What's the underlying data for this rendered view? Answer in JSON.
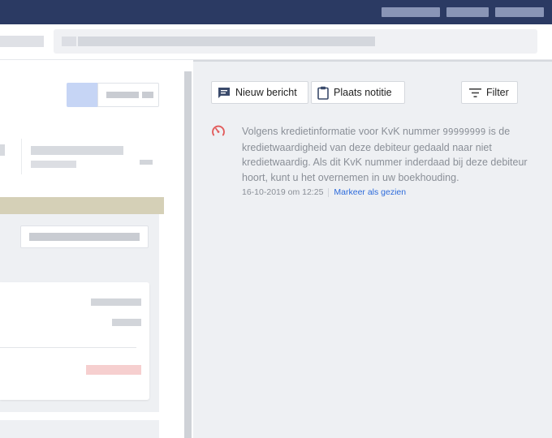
{
  "toolbar": {
    "new_message_label": "Nieuw bericht",
    "place_note_label": "Plaats notitie",
    "filter_label": "Filter"
  },
  "icons": {
    "new_message": "message-icon",
    "place_note": "clipboard-icon",
    "filter": "filter-icon",
    "feed_item": "speedometer-icon"
  },
  "feed": {
    "items": [
      {
        "text_before": "Volgens kredietinformatie voor KvK nummer ",
        "kvk_number": "99999999",
        "text_after": " is de kredietwaardigheid van deze debiteur gedaald naar niet kredietwaardig. Als dit KvK nummer inderdaad bij deze debiteur hoort, kunt u het overnemen in uw boekhouding.",
        "timestamp": "16-10-2019 om 12:25",
        "action_label": "Markeer als gezien"
      }
    ]
  },
  "colors": {
    "topbar": "#2b3a63",
    "link": "#2d6bdb",
    "alert_icon": "#e25b5b",
    "panel_bg": "#eef0f3",
    "band": "#d5d0b7"
  }
}
